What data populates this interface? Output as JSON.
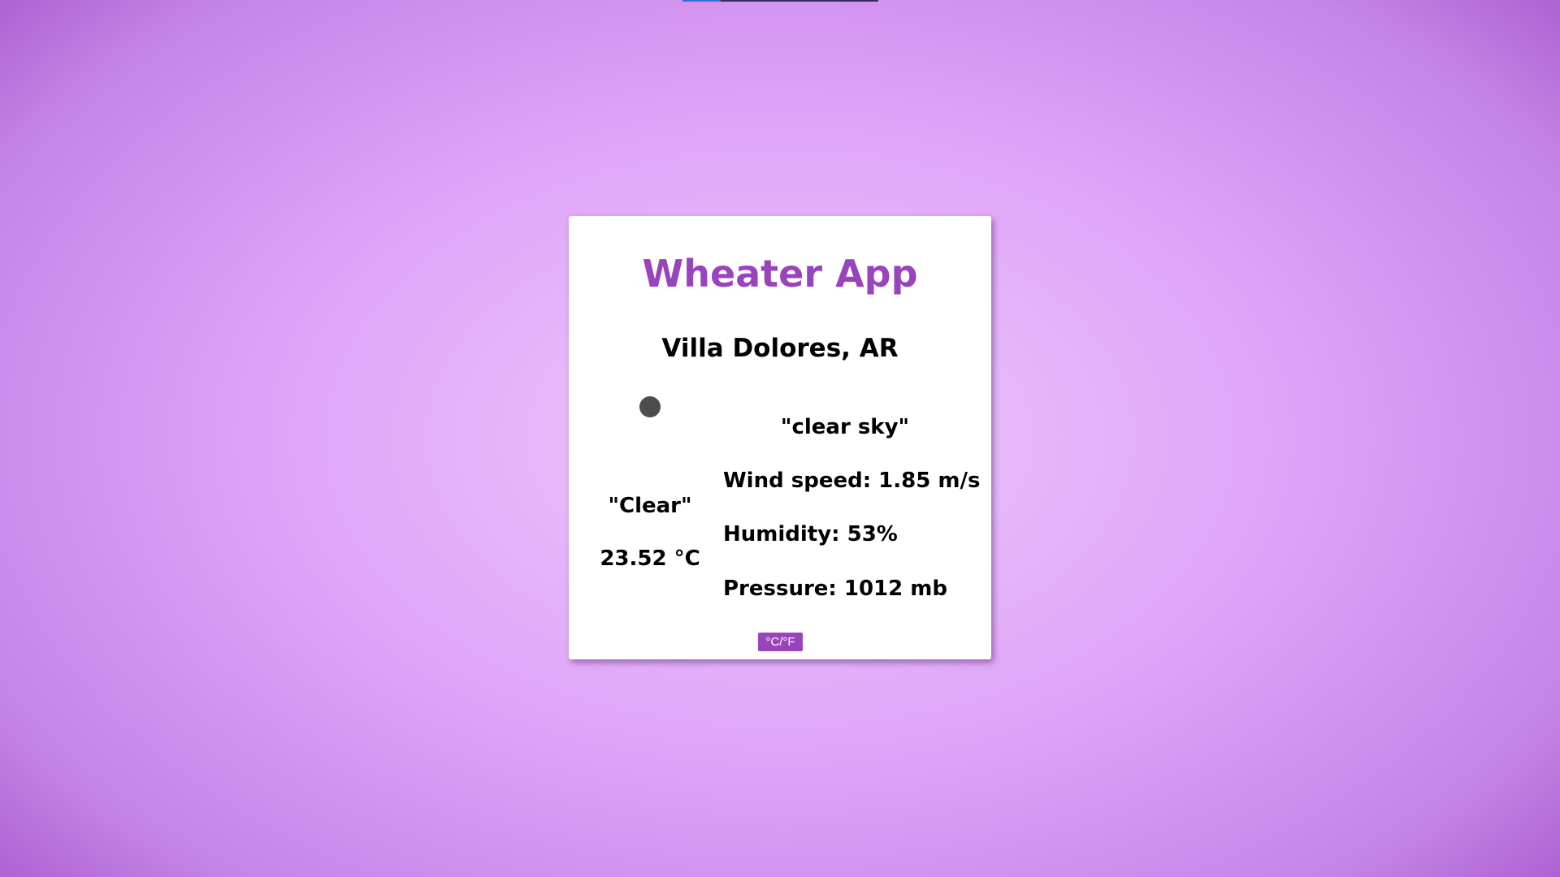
{
  "app": {
    "title": "Wheater App"
  },
  "location": {
    "name": "Villa Dolores, AR"
  },
  "current": {
    "icon": "weather-icon",
    "main": "\"Clear\"",
    "temperature": "23.52 °C",
    "description": "\"clear sky\"",
    "wind_speed": "Wind speed: 1.85 m/s",
    "humidity": "Humidity: 53%",
    "pressure": "Pressure: 1012 mb"
  },
  "controls": {
    "unit_toggle_label": "°C/°F"
  },
  "colors": {
    "accent": "#9a44bc",
    "card_background": "#ffffff",
    "icon_color": "#4d4d4d"
  }
}
